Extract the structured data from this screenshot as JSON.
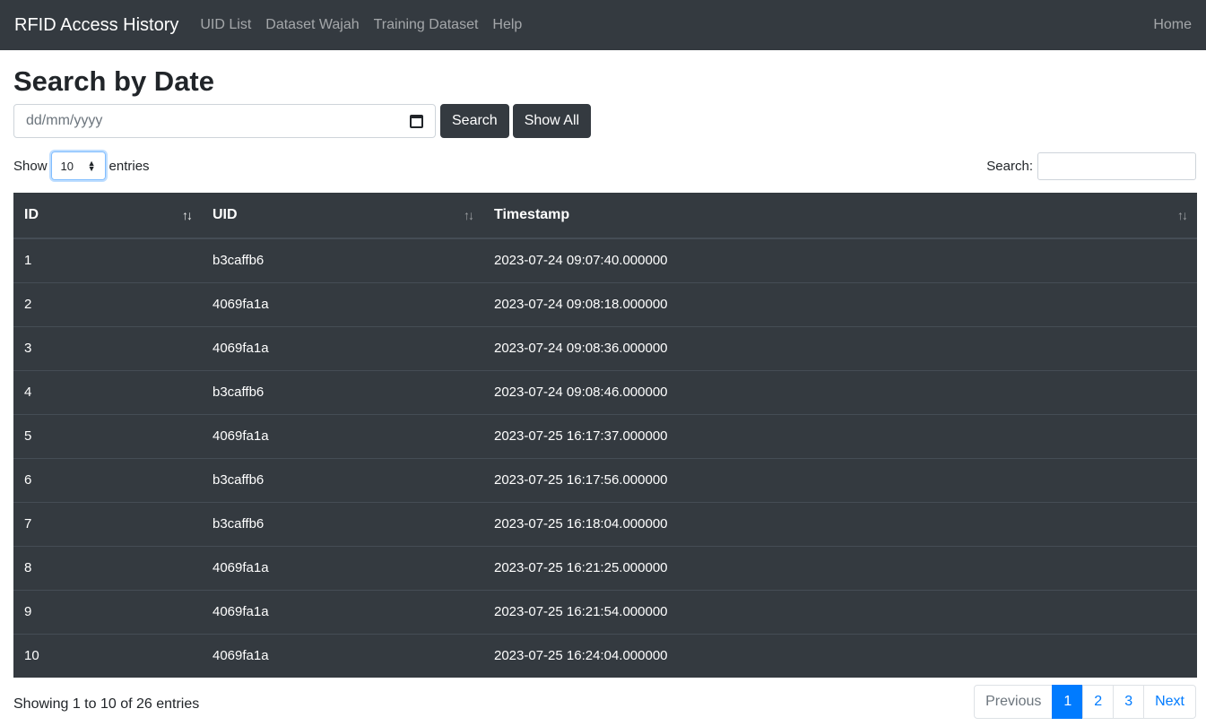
{
  "navbar": {
    "brand": "RFID Access History",
    "links": [
      "UID List",
      "Dataset Wajah",
      "Training Dataset",
      "Help"
    ],
    "right_link": "Home"
  },
  "page_title": "Search by Date",
  "date_search": {
    "placeholder": "dd/mm/yyyy",
    "search_label": "Search",
    "show_all_label": "Show All"
  },
  "table_controls": {
    "show_label": "Show",
    "entries_label": "entries",
    "page_length": "10",
    "search_label": "Search:"
  },
  "table": {
    "columns": [
      "ID",
      "UID",
      "Timestamp"
    ],
    "rows": [
      [
        "1",
        "b3caffb6",
        "2023-07-24 09:07:40.000000"
      ],
      [
        "2",
        "4069fa1a",
        "2023-07-24 09:08:18.000000"
      ],
      [
        "3",
        "4069fa1a",
        "2023-07-24 09:08:36.000000"
      ],
      [
        "4",
        "b3caffb6",
        "2023-07-24 09:08:46.000000"
      ],
      [
        "5",
        "4069fa1a",
        "2023-07-25 16:17:37.000000"
      ],
      [
        "6",
        "b3caffb6",
        "2023-07-25 16:17:56.000000"
      ],
      [
        "7",
        "b3caffb6",
        "2023-07-25 16:18:04.000000"
      ],
      [
        "8",
        "4069fa1a",
        "2023-07-25 16:21:25.000000"
      ],
      [
        "9",
        "4069fa1a",
        "2023-07-25 16:21:54.000000"
      ],
      [
        "10",
        "4069fa1a",
        "2023-07-25 16:24:04.000000"
      ]
    ]
  },
  "footer": {
    "info": "Showing 1 to 10 of 26 entries",
    "pagination": {
      "previous": "Previous",
      "pages": [
        "1",
        "2",
        "3"
      ],
      "next": "Next",
      "active_page": "1"
    }
  },
  "colors": {
    "navbar_bg": "#343a40",
    "table_bg": "#343a40",
    "accent": "#007bff"
  }
}
